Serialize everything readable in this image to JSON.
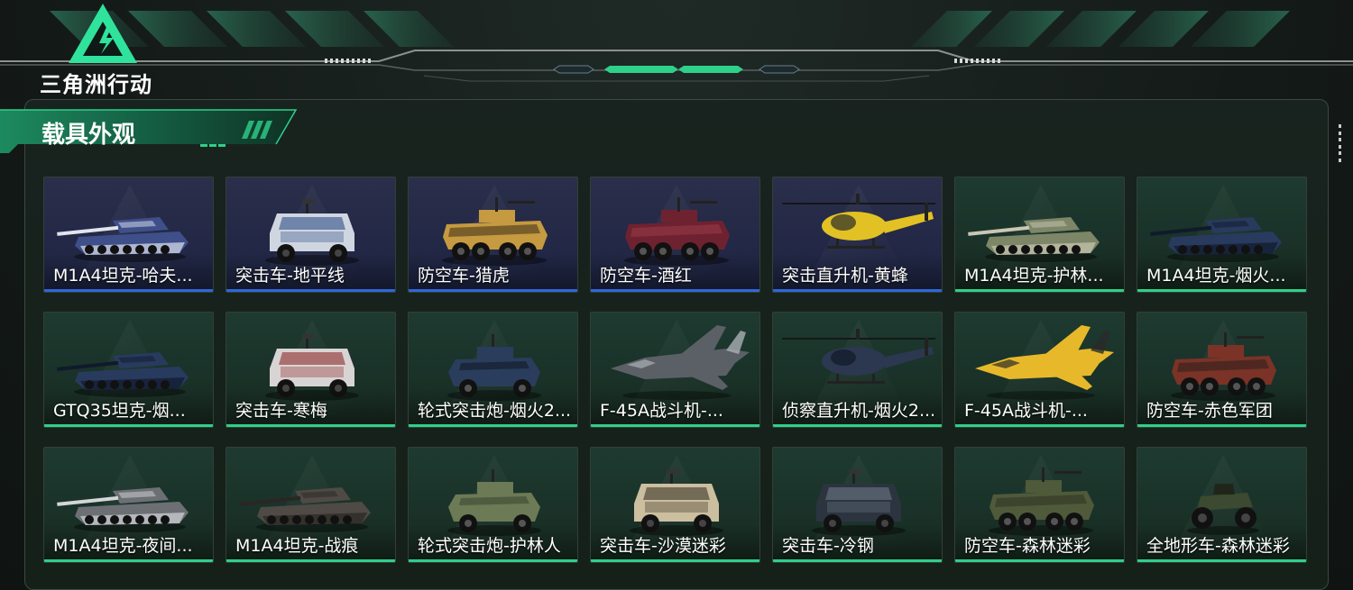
{
  "app": {
    "logo_text": "三角洲行动"
  },
  "section": {
    "title": "载具外观"
  },
  "colors": {
    "accent": "#2fd08a",
    "rare_blue": "#2f67d8",
    "panel_bg": "#152019"
  },
  "cards": [
    {
      "name": "M1A4坦克-哈夫...",
      "rarity": "blue",
      "icon": "tank-icon"
    },
    {
      "name": "突击车-地平线",
      "rarity": "blue",
      "icon": "assault-vehicle-icon"
    },
    {
      "name": "防空车-猎虎",
      "rarity": "blue",
      "icon": "aa-vehicle-icon"
    },
    {
      "name": "防空车-酒红",
      "rarity": "blue",
      "icon": "aa-vehicle-icon"
    },
    {
      "name": "突击直升机-黄蜂",
      "rarity": "blue",
      "icon": "attack-helicopter-icon"
    },
    {
      "name": "M1A4坦克-护林...",
      "rarity": "green",
      "icon": "tank-icon"
    },
    {
      "name": "M1A4坦克-烟火...",
      "rarity": "green",
      "icon": "tank-icon"
    },
    {
      "name": "GTQ35坦克-烟...",
      "rarity": "green",
      "icon": "tank-icon"
    },
    {
      "name": "突击车-寒梅",
      "rarity": "green",
      "icon": "assault-vehicle-icon"
    },
    {
      "name": "轮式突击炮-烟火2...",
      "rarity": "green",
      "icon": "wheeled-assault-gun-icon"
    },
    {
      "name": "F-45A战斗机-...",
      "rarity": "green",
      "icon": "fighter-jet-icon"
    },
    {
      "name": "侦察直升机-烟火2...",
      "rarity": "green",
      "icon": "scout-helicopter-icon"
    },
    {
      "name": "F-45A战斗机-...",
      "rarity": "green",
      "icon": "fighter-jet-icon"
    },
    {
      "name": "防空车-赤色军团",
      "rarity": "green",
      "icon": "aa-vehicle-icon"
    },
    {
      "name": "M1A4坦克-夜间...",
      "rarity": "green",
      "icon": "tank-icon"
    },
    {
      "name": "M1A4坦克-战痕",
      "rarity": "green",
      "icon": "tank-icon"
    },
    {
      "name": "轮式突击炮-护林人",
      "rarity": "green",
      "icon": "wheeled-assault-gun-icon"
    },
    {
      "name": "突击车-沙漠迷彩",
      "rarity": "green",
      "icon": "assault-vehicle-icon"
    },
    {
      "name": "突击车-冷钢",
      "rarity": "green",
      "icon": "assault-vehicle-icon"
    },
    {
      "name": "防空车-森林迷彩",
      "rarity": "green",
      "icon": "aa-vehicle-icon"
    },
    {
      "name": "全地形车-森林迷彩",
      "rarity": "green",
      "icon": "atv-icon"
    }
  ]
}
